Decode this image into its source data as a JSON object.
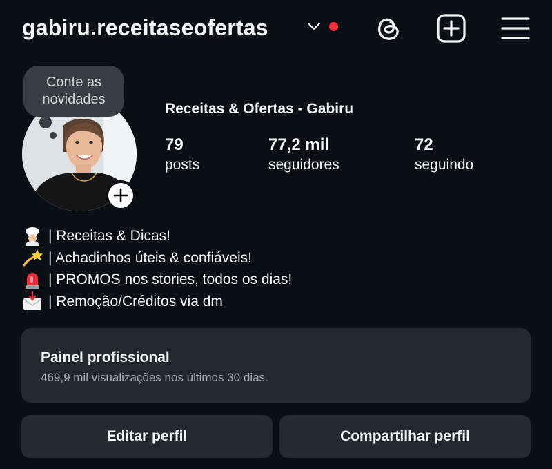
{
  "header": {
    "username": "gabiru.receitaseofertas",
    "notification_dot_color": "#ff3040",
    "icons": [
      "chevron-down-icon",
      "threads-icon",
      "new-post-icon",
      "menu-icon"
    ]
  },
  "note": {
    "text_line1": "Conte as",
    "text_line2": "novidades"
  },
  "profile": {
    "full_name": "Receitas & Ofertas - Gabiru",
    "stats": [
      {
        "value": "79",
        "label": "posts"
      },
      {
        "value": "77,2 mil",
        "label": "seguidores"
      },
      {
        "value": "72",
        "label": "seguindo"
      }
    ]
  },
  "bio": [
    {
      "emoji": "chef-emoji",
      "text": "| Receitas & Dicas!"
    },
    {
      "emoji": "shooting-star-emoji",
      "text": "| Achadinhos úteis & confiáveis!"
    },
    {
      "emoji": "siren-emoji",
      "text": "| PROMOS nos stories, todos os dias!"
    },
    {
      "emoji": "envelope-arrow-emoji",
      "text": "| Remoção/Créditos via dm"
    }
  ],
  "professional_panel": {
    "title": "Painel profissional",
    "subtitle": "469,9 mil visualizações nos últimos 30 dias."
  },
  "actions": {
    "edit_label": "Editar perfil",
    "share_label": "Compartilhar perfil"
  },
  "colors": {
    "background": "#0c1014",
    "card": "#25292e",
    "note_bubble": "#3a3d42"
  }
}
